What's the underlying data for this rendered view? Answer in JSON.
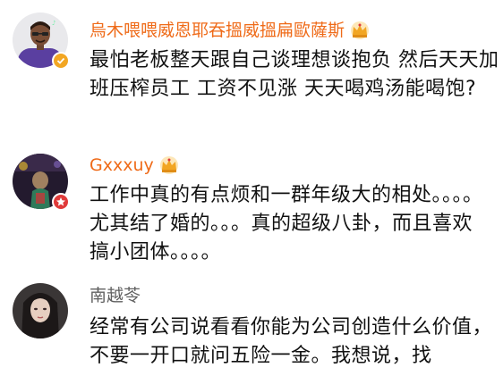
{
  "colors": {
    "vip_name": "#ef6b19",
    "normal_name": "#606060",
    "text": "#111111",
    "crown": "#f2a623",
    "badge_vip": "#f2a623",
    "badge_red": "#e03a3a"
  },
  "comments": [
    {
      "username": "烏木喂喂威恩耶吞搵威搵扁歐薩斯",
      "vip": true,
      "badge_icon": "check-badge-icon",
      "avatar_icon": "bitmoji-avatar",
      "content": "最怕老板整天跟自己谈理想谈抱负 然后天天加班压榨员工 工资不见涨 天天喝鸡汤能喝饱?"
    },
    {
      "username": "Gxxxuy",
      "vip": true,
      "badge_icon": "star-badge-icon",
      "avatar_icon": "dark-photo-avatar",
      "content": "工作中真的有点烦和一群年级大的相处。。。。尤其结了婚的。。。真的超级八卦，而且喜欢搞小团体。。。。"
    },
    {
      "username": "南越苓",
      "vip": false,
      "badge_icon": "",
      "avatar_icon": "girl-portrait-avatar",
      "content": "经常有公司说看看你能为公司创造什么价值，不要一开口就问五险一金。我想说，找"
    }
  ]
}
